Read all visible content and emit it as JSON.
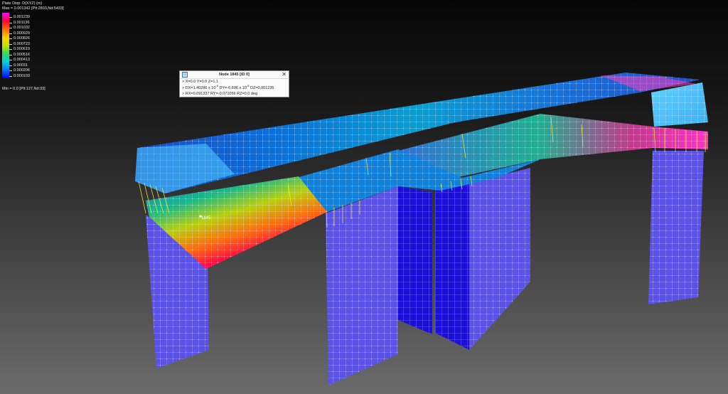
{
  "legend": {
    "title": "Plate Disp: D(XYZ) (m)",
    "max_text": "Max = 0.001342 [Plt:2803,Nd:5433]",
    "min_text": "Min = 0.0 [Plt:127,Nd:33]",
    "values": [
      "0.001239",
      "0.001136",
      "0.001032",
      "0.000929",
      "0.000826",
      "0.000723",
      "0.000619",
      "0.000516",
      "0.000413",
      "0.00031",
      "0.000206",
      "0.000103"
    ],
    "colors": [
      "#ff00ff",
      "#ff0033",
      "#ff6a00",
      "#ffd000",
      "#c8e000",
      "#3cd65a",
      "#00d0e0",
      "#0070ff",
      "#0000ff"
    ]
  },
  "node_info": {
    "title": "Node 1845  [ID 0]",
    "pin_icon": "pin-icon",
    "close_label": "✕",
    "coords": "> X=0.0 Y=0.0 Z=1.1",
    "disp_prefix": "> DX=1.40286 x 10",
    "disp_exp1": "-8",
    "disp_mid": " DY=-6.696 x 10",
    "disp_exp2": "-8",
    "disp_suffix": " DZ=0.001235",
    "rot": "> RX=0.091337 RY=-0.071056 RZ=0.0 deg"
  },
  "scene": {
    "node_label": "1845",
    "wall_color": "#5a52e6",
    "mesh_color": "#e8e8ff",
    "support_color": "#ffee33"
  }
}
